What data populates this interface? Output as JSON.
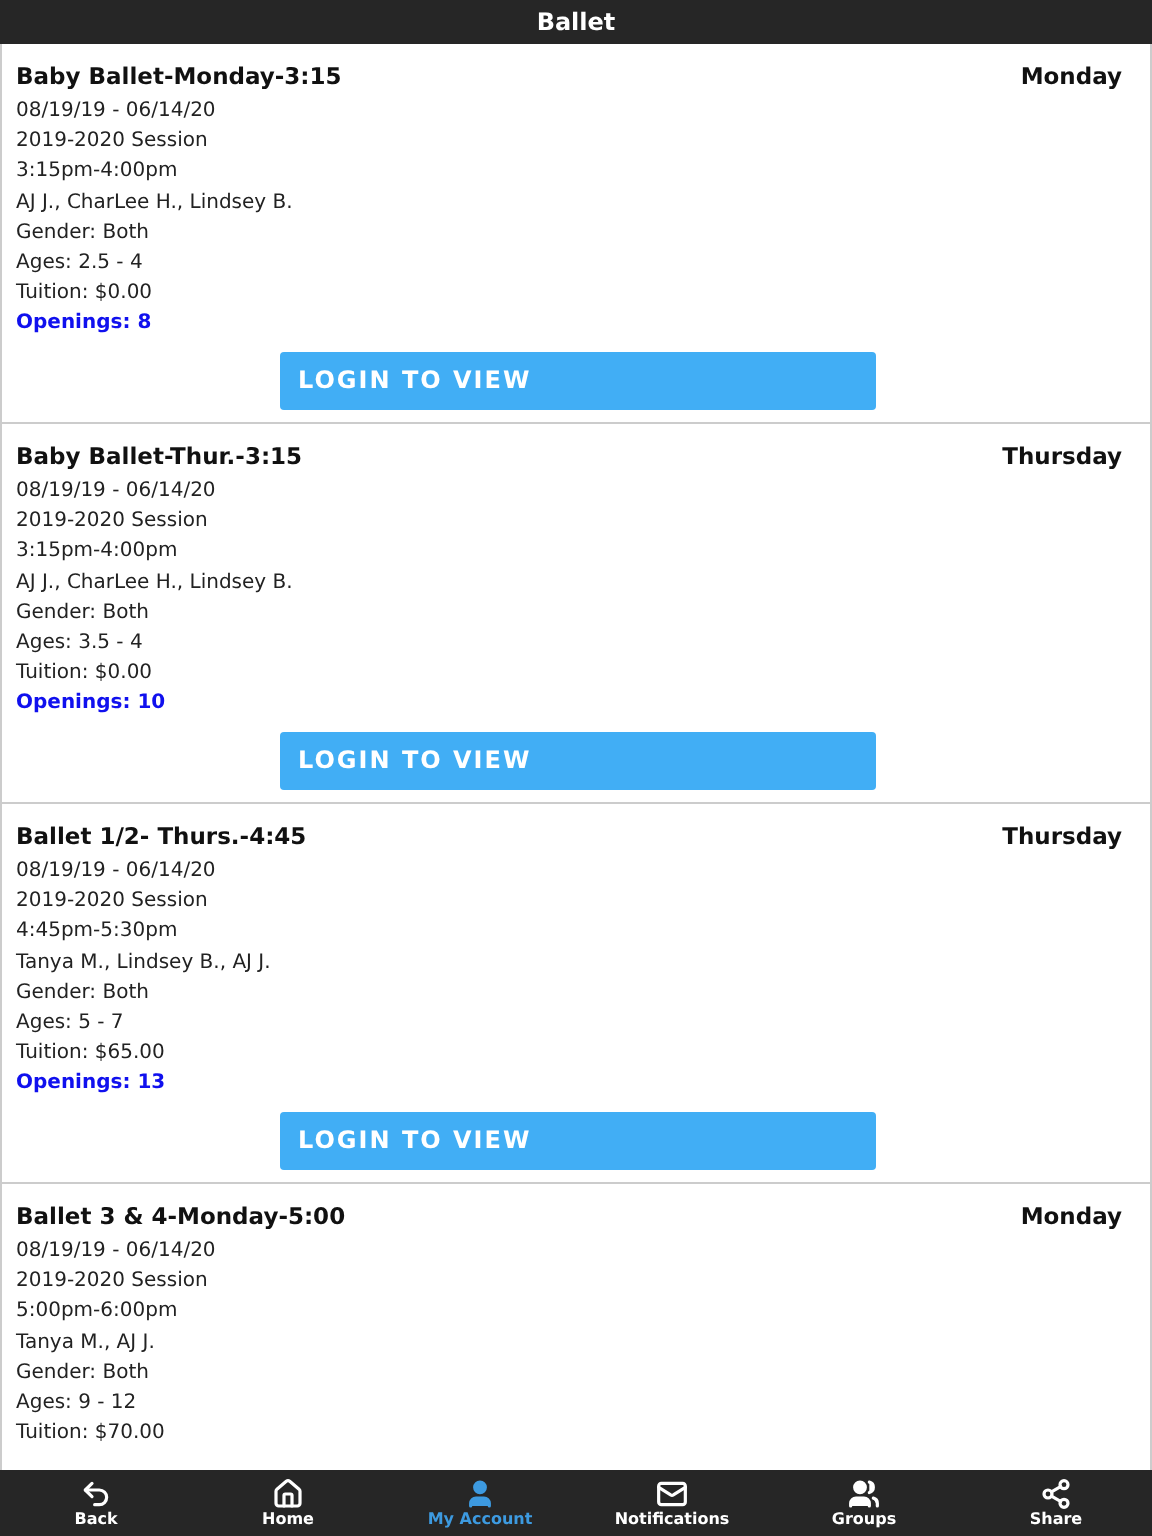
{
  "header": {
    "title": "Ballet"
  },
  "classes": [
    {
      "name": "Baby Ballet-Monday-3:15",
      "day": "Monday",
      "lines": [
        "08/19/19 - 06/14/20",
        "2019-2020 Session",
        "3:15pm-4:00pm",
        "AJ J., CharLee H., Lindsey B.",
        "Gender: Both",
        "Ages: 2.5 - 4",
        "Tuition: $0.00"
      ],
      "openings": "Openings: 8",
      "button": "LOGIN TO VIEW"
    },
    {
      "name": "Baby Ballet-Thur.-3:15",
      "day": "Thursday",
      "lines": [
        "08/19/19 - 06/14/20",
        "2019-2020 Session",
        "3:15pm-4:00pm",
        "AJ J., CharLee H., Lindsey B.",
        "Gender: Both",
        "Ages: 3.5 - 4",
        "Tuition: $0.00"
      ],
      "openings": "Openings: 10",
      "button": "LOGIN TO VIEW"
    },
    {
      "name": "Ballet 1/2- Thurs.-4:45",
      "day": "Thursday",
      "lines": [
        "08/19/19 - 06/14/20",
        "2019-2020 Session",
        "4:45pm-5:30pm",
        "Tanya M., Lindsey B., AJ J.",
        "Gender: Both",
        "Ages: 5 - 7",
        "Tuition: $65.00"
      ],
      "openings": "Openings: 13",
      "button": "LOGIN TO VIEW"
    },
    {
      "name": "Ballet 3 & 4-Monday-5:00",
      "day": "Monday",
      "lines": [
        "08/19/19 - 06/14/20",
        "2019-2020 Session",
        "5:00pm-6:00pm",
        "Tanya M., AJ J.",
        "Gender: Both",
        "Ages: 9 - 12",
        "Tuition: $70.00"
      ]
    }
  ],
  "tabs": [
    {
      "label": "Back",
      "kind": "back",
      "selected": false
    },
    {
      "label": "Home",
      "kind": "home",
      "selected": false
    },
    {
      "label": "My Account",
      "kind": "account",
      "selected": true
    },
    {
      "label": "Notifications",
      "kind": "notifications",
      "selected": false
    },
    {
      "label": "Groups",
      "kind": "groups",
      "selected": false
    },
    {
      "label": "Share",
      "kind": "share",
      "selected": false
    }
  ]
}
